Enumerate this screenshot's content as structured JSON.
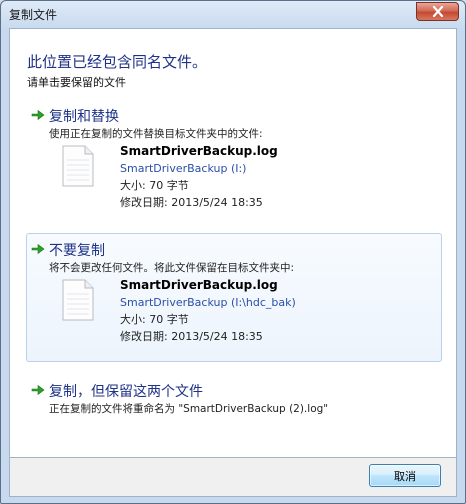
{
  "window": {
    "title": "复制文件",
    "close_icon": "close-icon"
  },
  "heading": "此位置已经包含同名文件。",
  "subheading": "请单击要保留的文件",
  "options": [
    {
      "title": "复制和替换",
      "description": "使用正在复制的文件替换目标文件夹中的文件:",
      "file": {
        "name": "SmartDriverBackup.log",
        "location": "SmartDriverBackup (I:)",
        "size": "大小: 70 字节",
        "modified": "修改日期: 2013/5/24 18:35"
      }
    },
    {
      "title": "不要复制",
      "description": "将不会更改任何文件。将此文件保留在目标文件夹中:",
      "file": {
        "name": "SmartDriverBackup.log",
        "location": "SmartDriverBackup (I:\\hdc_bak)",
        "size": "大小: 70 字节",
        "modified": "修改日期: 2013/5/24 18:35"
      }
    },
    {
      "title": "复制，但保留这两个文件",
      "description": "正在复制的文件将重命名为 \"SmartDriverBackup (2).log\""
    }
  ],
  "footer": {
    "cancel_label": "取消"
  },
  "colors": {
    "accent": "#1e3287",
    "arrow": "#2f9d2c",
    "link": "#2a4fa7",
    "close": "#c44a31"
  }
}
